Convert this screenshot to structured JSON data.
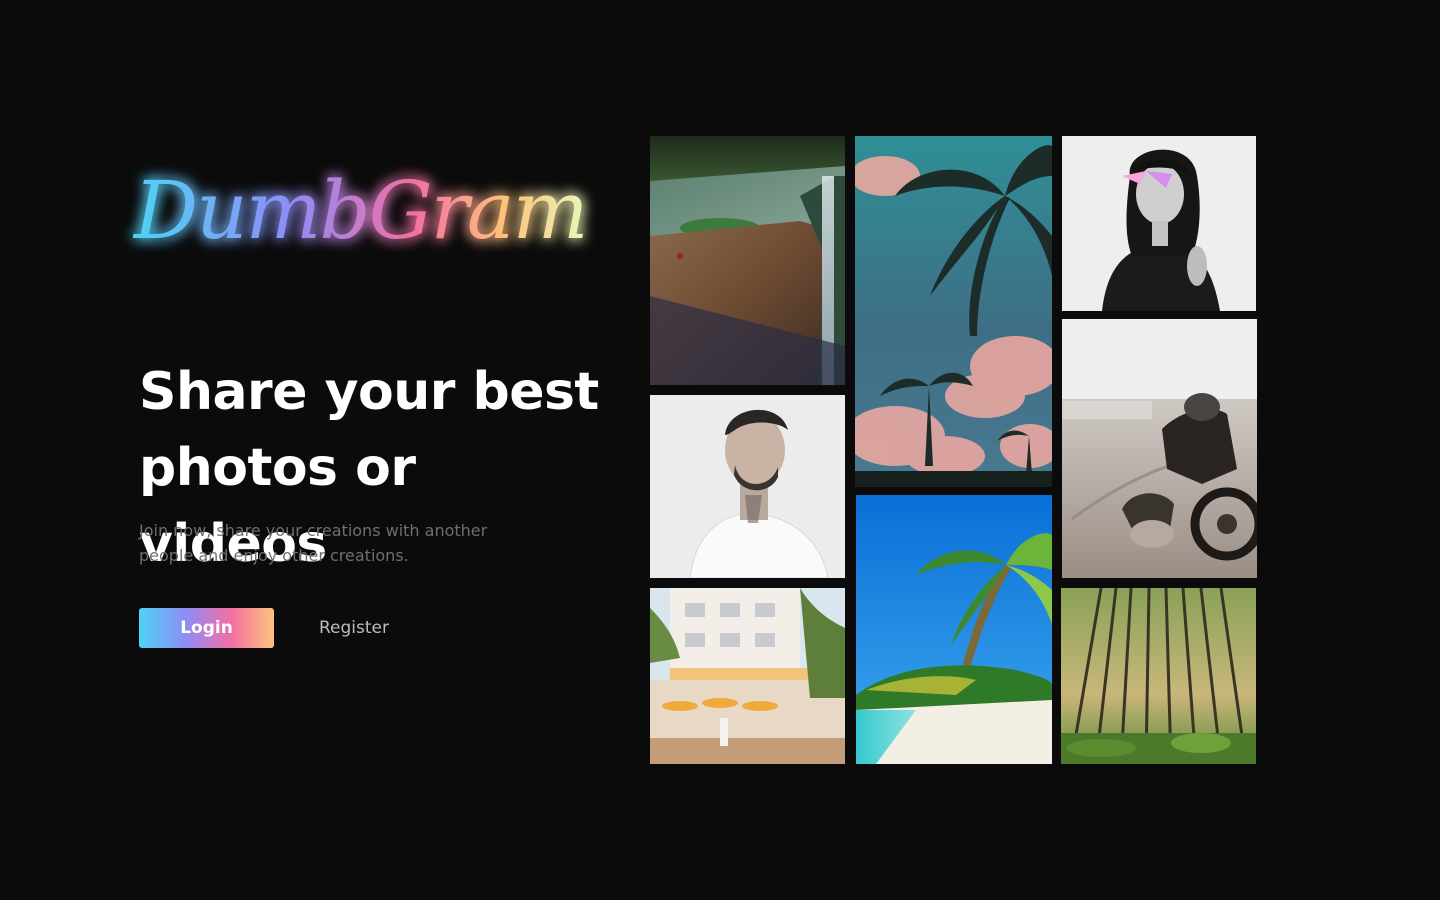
{
  "brand": {
    "name": "DumbGram",
    "colors": {
      "cyan": "#4fd3f5",
      "violet": "#8f8cf5",
      "pink": "#f36fa4",
      "peach": "#fdc27b"
    }
  },
  "hero": {
    "headline_line1": "Share your best",
    "headline_line2": "photos or videos",
    "subtext_line1": "Join now, share your creations with another",
    "subtext_line2": "people and enjoy other creations."
  },
  "actions": {
    "login_label": "Login",
    "register_label": "Register"
  },
  "gallery": {
    "photos": [
      "waterfall-cliff-photo",
      "palm-trees-pink-sky-photo",
      "woman-portrait-bw-photo",
      "man-tattoo-portrait-photo",
      "motorcycle-sand-photo",
      "tropical-beach-photo",
      "hotel-street-cafe-photo",
      "pine-forest-photo"
    ]
  },
  "theme": {
    "background": "#0b0b0b",
    "headline_color": "#ffffff",
    "subtext_color": "#6f6f6f",
    "register_color": "#bdbdbd"
  }
}
